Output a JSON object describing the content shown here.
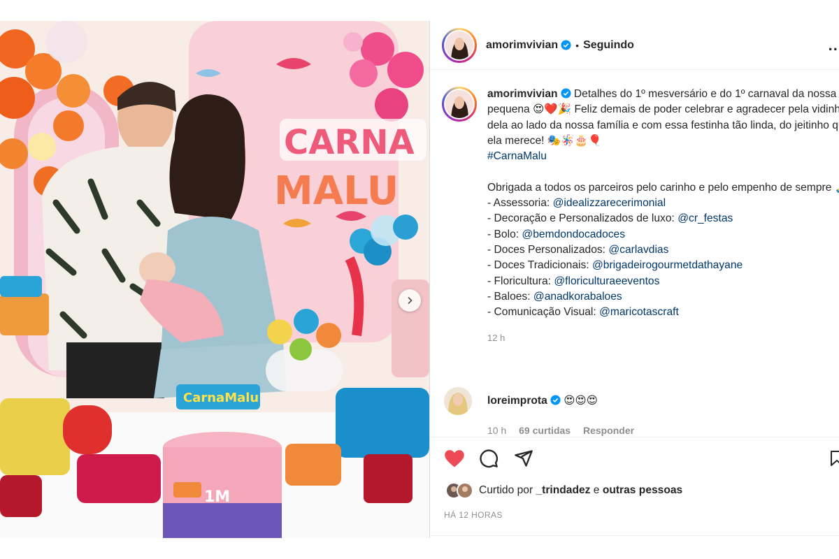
{
  "post": {
    "author": "amorimvivian",
    "follow_status": "Seguindo",
    "separator": "•",
    "more": "...",
    "caption": {
      "author": "amorimvivian",
      "p1": "Detalhes do 1º mesversário e do 1º carnaval da nossa pequena 😍❤️🎉 Feliz demais de poder celebrar e agradecer pela vidinha dela ao lado da nossa família e com essa festinha tão linda, do jeitinho que ela merece! 🎭🪅🎂🎈",
      "hashtag": "#CarnaMalu",
      "p2": "Obrigada a todos os parceiros pelo carinho e pelo empenho de sempre 🙏",
      "credits": [
        {
          "label": "- Assessoria: ",
          "handle": "@idealizzarecerimonial"
        },
        {
          "label": "- Decoração e Personalizados de luxo: ",
          "handle": "@cr_festas"
        },
        {
          "label": "- Bolo: ",
          "handle": "@bemdondocadoces"
        },
        {
          "label": "- Doces Personalizados: ",
          "handle": "@carlavdias"
        },
        {
          "label": "- Doces Tradicionais: ",
          "handle": "@brigadeirogourmetdathayane"
        },
        {
          "label": "- Floricultura: ",
          "handle": "@floriculturaeeventos"
        },
        {
          "label": "- Baloes: ",
          "handle": "@anadkorabaloes"
        },
        {
          "label": "- Comunicação Visual: ",
          "handle": "@maricotascraft"
        }
      ],
      "time": "12 h"
    },
    "comment": {
      "author": "loreimprota",
      "text": "😍😍😍",
      "time": "10 h",
      "likes": "69 curtidas",
      "reply": "Responder"
    },
    "likes_line": {
      "prefix": "Curtido por ",
      "user": "_trindadez",
      "middle": " e ",
      "others": "outras pessoas"
    },
    "posted": "HÁ 12 HORAS",
    "image": {
      "banner_top": "CARNA",
      "banner_bottom": "MALU",
      "cake_topper": "CarnaMalu",
      "cake_number": "1M"
    }
  },
  "colors": {
    "link": "#00376b",
    "like": "#ed4956",
    "verified": "#0095f6",
    "muted": "#8e8e8e"
  },
  "icons": [
    "heart-icon",
    "comment-icon",
    "share-icon",
    "bookmark-icon",
    "verified-badge-icon",
    "chevron-right-icon",
    "more-icon"
  ]
}
